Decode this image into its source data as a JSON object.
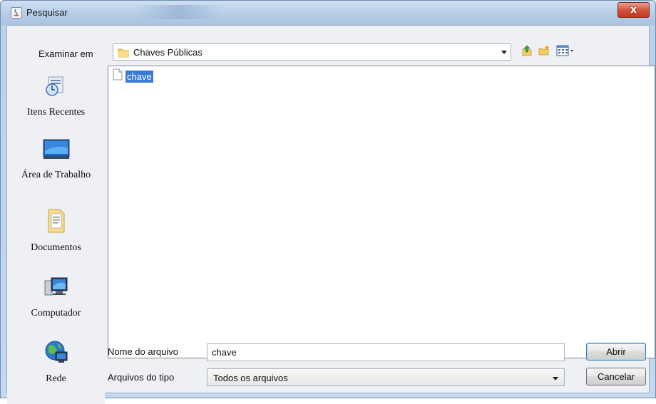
{
  "window": {
    "title": "Pesquisar",
    "close_glyph": "x"
  },
  "lookin": {
    "label": "Examinar em",
    "value": "Chaves Públicas",
    "icon": "folder-icon"
  },
  "toolbar": {
    "buttons": [
      {
        "name": "up-folder-icon"
      },
      {
        "name": "new-folder-icon"
      },
      {
        "name": "view-menu-icon"
      }
    ]
  },
  "places": [
    {
      "label": "Itens Recentes",
      "icon": "recent-items-icon"
    },
    {
      "label": "Área de Trabalho",
      "icon": "desktop-icon"
    },
    {
      "label": "Documentos",
      "icon": "documents-icon"
    },
    {
      "label": "Computador",
      "icon": "computer-icon"
    },
    {
      "label": "Rede",
      "icon": "network-icon"
    }
  ],
  "files": [
    {
      "name": "chave",
      "selected": true,
      "icon": "file-icon"
    }
  ],
  "filename": {
    "label": "Nome do arquivo",
    "value": "chave"
  },
  "filetype": {
    "label": "Arquivos do tipo",
    "value": "Todos os arquivos"
  },
  "buttons": {
    "open": "Abrir",
    "cancel": "Cancelar"
  },
  "colors": {
    "selection": "#3a7bd5",
    "close": "#c4391f"
  }
}
